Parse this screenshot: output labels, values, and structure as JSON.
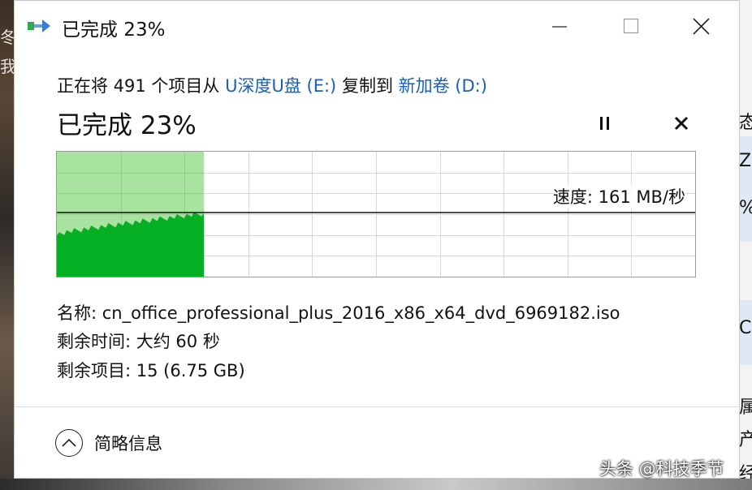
{
  "window": {
    "title": "已完成 23%"
  },
  "copy": {
    "prefix": "正在将 491 个项目从 ",
    "source": "U深度U盘 (E:)",
    "middle": " 复制到 ",
    "destination": "新加卷 (D:)"
  },
  "status": {
    "big_label": "已完成 23%",
    "progress_fraction": 0.23
  },
  "graph": {
    "speed_label": "速度: 161 MB/秒"
  },
  "details": {
    "name": "名称: cn_office_professional_plus_2016_x86_x64_dvd_6969182.iso",
    "time_remaining": "剩余时间: 大约 60 秒",
    "items_remaining": "剩余项目: 15 (6.75 GB)"
  },
  "toggle": {
    "label": "简略信息"
  },
  "colors": {
    "progress_light": "#a8e4a0",
    "progress_dark": "#06b025",
    "link": "#1a5fb4"
  },
  "icons": {
    "title": "copy-arrow-icon",
    "pause": "pause-icon",
    "cancel": "close-icon",
    "toggle": "chevron-up-icon"
  },
  "background": {
    "watermark": "头条 @科技季节",
    "left_fragments": [
      "冬",
      "我"
    ],
    "right_fragments": [
      "态",
      "Z",
      "%",
      "C",
      "属",
      "产",
      "经"
    ]
  }
}
